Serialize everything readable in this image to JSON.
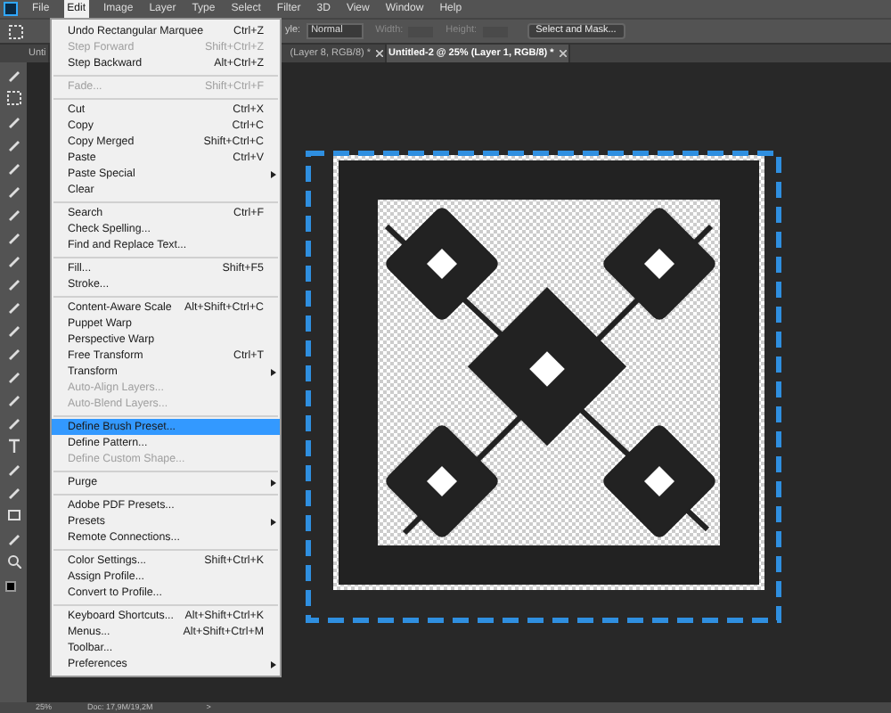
{
  "menu_bar": {
    "items": [
      {
        "label": "File",
        "selected": false
      },
      {
        "label": "Edit",
        "selected": true
      },
      {
        "label": "Image",
        "selected": false
      },
      {
        "label": "Layer",
        "selected": false
      },
      {
        "label": "Type",
        "selected": false
      },
      {
        "label": "Select",
        "selected": false
      },
      {
        "label": "Filter",
        "selected": false
      },
      {
        "label": "3D",
        "selected": false
      },
      {
        "label": "View",
        "selected": false
      },
      {
        "label": "Window",
        "selected": false
      },
      {
        "label": "Help",
        "selected": false
      }
    ]
  },
  "options_bar": {
    "style_label": "yle:",
    "style_value": "Normal",
    "width_label": "Width:",
    "height_label": "Height:",
    "button": "Select and Mask..."
  },
  "tabs": [
    {
      "label": "Unti",
      "selected": false
    },
    {
      "label": "(Layer 8, RGB/8) *",
      "selected": false
    },
    {
      "label": "Untitled-2 @ 25% (Layer 1, RGB/8) *",
      "selected": true
    }
  ],
  "edit_menu": {
    "items": [
      {
        "kind": "item",
        "label": "Undo Rectangular Marquee",
        "shortcut": "Ctrl+Z",
        "disabled": false,
        "selected": false,
        "submenu": false
      },
      {
        "kind": "item",
        "label": "Step Forward",
        "shortcut": "Shift+Ctrl+Z",
        "disabled": true,
        "selected": false,
        "submenu": false
      },
      {
        "kind": "item",
        "label": "Step Backward",
        "shortcut": "Alt+Ctrl+Z",
        "disabled": false,
        "selected": false,
        "submenu": false
      },
      {
        "kind": "separator"
      },
      {
        "kind": "item",
        "label": "Fade...",
        "shortcut": "Shift+Ctrl+F",
        "disabled": true,
        "selected": false,
        "submenu": false
      },
      {
        "kind": "separator"
      },
      {
        "kind": "item",
        "label": "Cut",
        "shortcut": "Ctrl+X",
        "disabled": false,
        "selected": false,
        "submenu": false
      },
      {
        "kind": "item",
        "label": "Copy",
        "shortcut": "Ctrl+C",
        "disabled": false,
        "selected": false,
        "submenu": false
      },
      {
        "kind": "item",
        "label": "Copy Merged",
        "shortcut": "Shift+Ctrl+C",
        "disabled": false,
        "selected": false,
        "submenu": false
      },
      {
        "kind": "item",
        "label": "Paste",
        "shortcut": "Ctrl+V",
        "disabled": false,
        "selected": false,
        "submenu": false
      },
      {
        "kind": "item",
        "label": "Paste Special",
        "disabled": false,
        "selected": false,
        "submenu": true
      },
      {
        "kind": "item",
        "label": "Clear",
        "disabled": false,
        "selected": false,
        "submenu": false
      },
      {
        "kind": "separator"
      },
      {
        "kind": "item",
        "label": "Search",
        "shortcut": "Ctrl+F",
        "disabled": false,
        "selected": false,
        "submenu": false
      },
      {
        "kind": "item",
        "label": "Check Spelling...",
        "disabled": false,
        "selected": false,
        "submenu": false
      },
      {
        "kind": "item",
        "label": "Find and Replace Text...",
        "disabled": false,
        "selected": false,
        "submenu": false
      },
      {
        "kind": "separator"
      },
      {
        "kind": "item",
        "label": "Fill...",
        "shortcut": "Shift+F5",
        "disabled": false,
        "selected": false,
        "submenu": false
      },
      {
        "kind": "item",
        "label": "Stroke...",
        "disabled": false,
        "selected": false,
        "submenu": false
      },
      {
        "kind": "separator"
      },
      {
        "kind": "item",
        "label": "Content-Aware Scale",
        "shortcut": "Alt+Shift+Ctrl+C",
        "disabled": false,
        "selected": false,
        "submenu": false
      },
      {
        "kind": "item",
        "label": "Puppet Warp",
        "disabled": false,
        "selected": false,
        "submenu": false
      },
      {
        "kind": "item",
        "label": "Perspective Warp",
        "disabled": false,
        "selected": false,
        "submenu": false
      },
      {
        "kind": "item",
        "label": "Free Transform",
        "shortcut": "Ctrl+T",
        "disabled": false,
        "selected": false,
        "submenu": false
      },
      {
        "kind": "item",
        "label": "Transform",
        "disabled": false,
        "selected": false,
        "submenu": true
      },
      {
        "kind": "item",
        "label": "Auto-Align Layers...",
        "disabled": true,
        "selected": false,
        "submenu": false
      },
      {
        "kind": "item",
        "label": "Auto-Blend Layers...",
        "disabled": true,
        "selected": false,
        "submenu": false
      },
      {
        "kind": "separator"
      },
      {
        "kind": "item",
        "label": "Define Brush Preset...",
        "disabled": false,
        "selected": true,
        "submenu": false
      },
      {
        "kind": "item",
        "label": "Define Pattern...",
        "disabled": false,
        "selected": false,
        "submenu": false
      },
      {
        "kind": "item",
        "label": "Define Custom Shape...",
        "disabled": true,
        "selected": false,
        "submenu": false
      },
      {
        "kind": "separator"
      },
      {
        "kind": "item",
        "label": "Purge",
        "disabled": false,
        "selected": false,
        "submenu": true
      },
      {
        "kind": "separator"
      },
      {
        "kind": "item",
        "label": "Adobe PDF Presets...",
        "disabled": false,
        "selected": false,
        "submenu": false
      },
      {
        "kind": "item",
        "label": "Presets",
        "disabled": false,
        "selected": false,
        "submenu": true
      },
      {
        "kind": "item",
        "label": "Remote Connections...",
        "disabled": false,
        "selected": false,
        "submenu": false
      },
      {
        "kind": "separator"
      },
      {
        "kind": "item",
        "label": "Color Settings...",
        "shortcut": "Shift+Ctrl+K",
        "disabled": false,
        "selected": false,
        "submenu": false
      },
      {
        "kind": "item",
        "label": "Assign Profile...",
        "disabled": false,
        "selected": false,
        "submenu": false
      },
      {
        "kind": "item",
        "label": "Convert to Profile...",
        "disabled": false,
        "selected": false,
        "submenu": false
      },
      {
        "kind": "separator"
      },
      {
        "kind": "item",
        "label": "Keyboard Shortcuts...",
        "shortcut": "Alt+Shift+Ctrl+K",
        "disabled": false,
        "selected": false,
        "submenu": false
      },
      {
        "kind": "item",
        "label": "Menus...",
        "shortcut": "Alt+Shift+Ctrl+M",
        "disabled": false,
        "selected": false,
        "submenu": false
      },
      {
        "kind": "item",
        "label": "Toolbar...",
        "disabled": false,
        "selected": false,
        "submenu": false
      },
      {
        "kind": "item",
        "label": "Preferences",
        "disabled": false,
        "selected": false,
        "submenu": true
      }
    ]
  },
  "status_bar": {
    "zoom": "25%",
    "doc_size": "Doc: 17,9M/19,2M",
    "arrow": ">"
  }
}
